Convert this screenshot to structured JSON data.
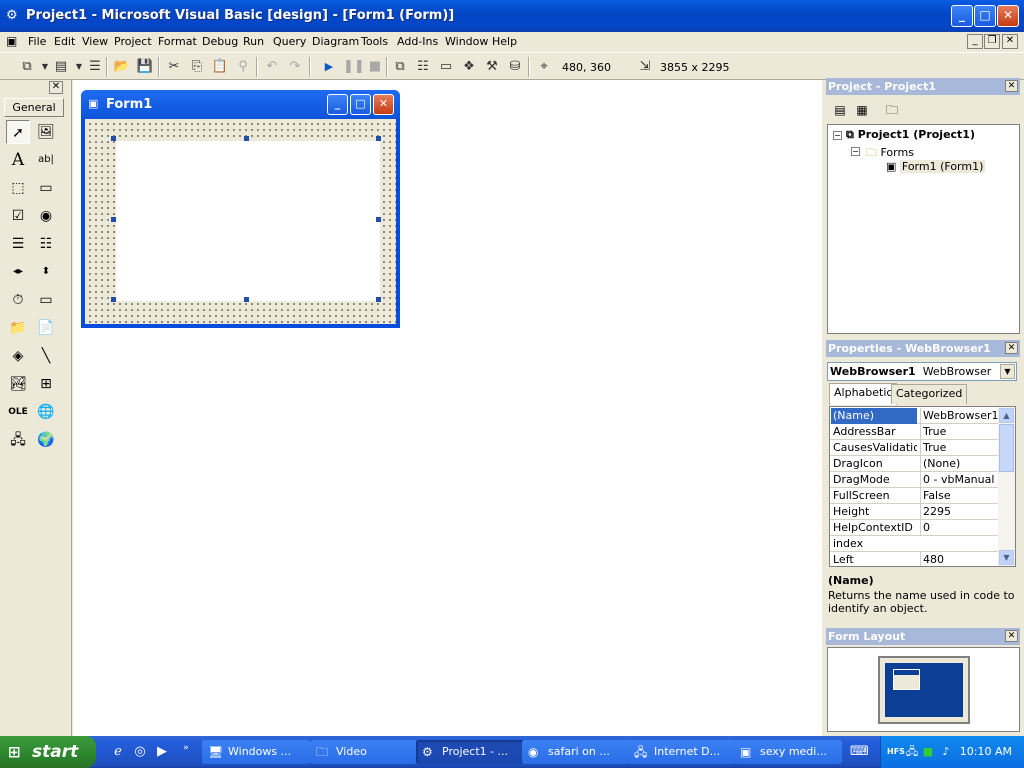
{
  "window": {
    "title": "Project1 - Microsoft Visual Basic [design] - [Form1 (Form)]",
    "minimize": "_",
    "maximize": "□",
    "close": "✕"
  },
  "menubar": {
    "items": [
      "File",
      "Edit",
      "View",
      "Project",
      "Format",
      "Debug",
      "Run",
      "Query",
      "Diagram",
      "Tools",
      "Add-Ins",
      "Window",
      "Help"
    ]
  },
  "toolbar": {
    "position_readout": "480, 360",
    "size_readout": "3855 x 2295"
  },
  "toolbox": {
    "tab_label": "General",
    "close": "✕"
  },
  "form_window": {
    "title": "Form1"
  },
  "project_panel": {
    "title": "Project - Project1",
    "tree": {
      "root": "Project1 (Project1)",
      "folder": "Forms",
      "item": "Form1 (Form1)"
    }
  },
  "properties_panel": {
    "title": "Properties - WebBrowser1",
    "object_name": "WebBrowser1",
    "object_type": "WebBrowser",
    "tabs": [
      "Alphabetic",
      "Categorized"
    ],
    "rows": [
      {
        "name": "(Name)",
        "value": "WebBrowser1"
      },
      {
        "name": "AddressBar",
        "value": "True"
      },
      {
        "name": "CausesValidation",
        "value": "True"
      },
      {
        "name": "DragIcon",
        "value": "(None)"
      },
      {
        "name": "DragMode",
        "value": "0 - vbManual"
      },
      {
        "name": "FullScreen",
        "value": "False"
      },
      {
        "name": "Height",
        "value": "2295"
      },
      {
        "name": "HelpContextID",
        "value": "0"
      },
      {
        "name": "index",
        "value": ""
      },
      {
        "name": "Left",
        "value": "480"
      }
    ],
    "description_title": "(Name)",
    "description_text": "Returns the name used in code to identify an object."
  },
  "form_layout_panel": {
    "title": "Form Layout"
  },
  "taskbar": {
    "start_label": "start",
    "tasks": [
      {
        "label": "Windows ...",
        "icon": "window-icon"
      },
      {
        "label": "Video",
        "icon": "folder-icon"
      },
      {
        "label": "Project1 - ...",
        "icon": "vb-icon"
      },
      {
        "label": "safari on ...",
        "icon": "compass-icon"
      },
      {
        "label": "Internet D...",
        "icon": "network-icon"
      },
      {
        "label": "sexy medi...",
        "icon": "media-icon"
      }
    ],
    "clock": "10:10 AM",
    "tray_hfs": "HFS"
  },
  "colors": {
    "titlebar": "#0A5DE2",
    "panel_title": "#A8B8D8",
    "selection": "#316AC5",
    "start_green": "#3C9A3C"
  }
}
